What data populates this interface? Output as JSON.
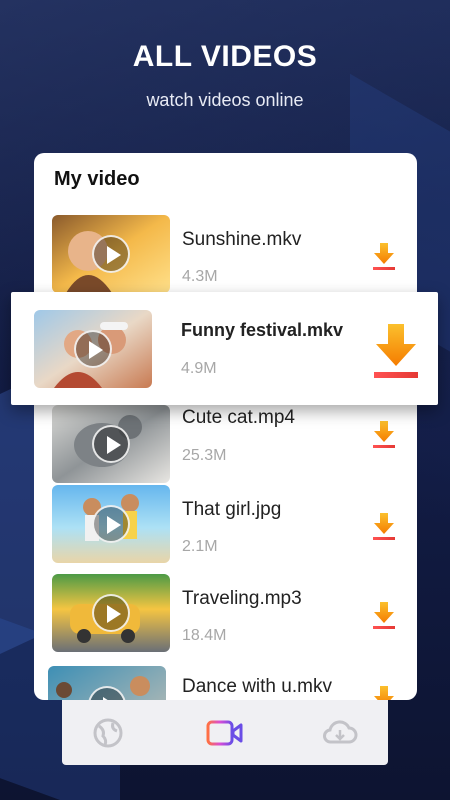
{
  "header": {
    "title": "ALL VIDEOS",
    "subtitle": "watch videos online"
  },
  "card": {
    "title": "My video"
  },
  "videos": [
    {
      "name": "Sunshine.mkv",
      "size": "4.3M"
    },
    {
      "name": "Funny festival.mkv",
      "size": "4.9M"
    },
    {
      "name": "Cute cat.mp4",
      "size": "25.3M"
    },
    {
      "name": "That girl.jpg",
      "size": "2.1M"
    },
    {
      "name": "Traveling.mp3",
      "size": "18.4M"
    },
    {
      "name": "Dance with u.mkv",
      "size": ""
    }
  ],
  "tabs": [
    {
      "icon": "globe-icon",
      "active": false
    },
    {
      "icon": "video-camera-icon",
      "active": true
    },
    {
      "icon": "cloud-download-icon",
      "active": false
    }
  ],
  "colors": {
    "download_top": "#f9a825",
    "download_bottom": "#f44336",
    "tab_active_start": "#ff6b35",
    "tab_active_end": "#7b3fe4",
    "tab_inactive": "#c3c3c8"
  }
}
